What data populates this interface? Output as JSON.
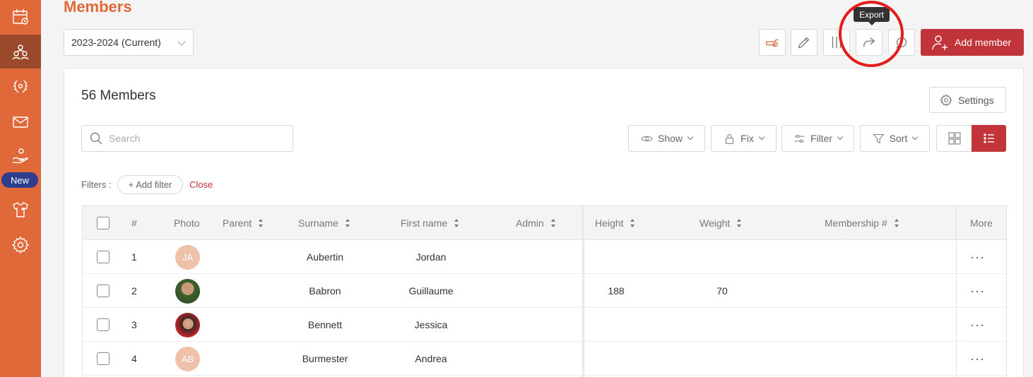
{
  "sidebar": {
    "items": [
      {
        "name": "calendar",
        "icon": "calendar-icon",
        "active": false
      },
      {
        "name": "members",
        "icon": "people-icon",
        "active": true
      },
      {
        "name": "competitions",
        "icon": "laurel-icon",
        "active": false
      },
      {
        "name": "messages",
        "icon": "mail-icon",
        "active": false
      },
      {
        "name": "donations",
        "icon": "hand-heart-icon",
        "active": false
      },
      {
        "name": "equipment",
        "icon": "shirt-icon",
        "active": false
      },
      {
        "name": "settings",
        "icon": "gear-icon",
        "active": false
      }
    ],
    "new_badge": "New",
    "accent": "#e0693a"
  },
  "header": {
    "title": "Members",
    "season_select": "2023-2024 (Current)",
    "tooltip": "Export",
    "add_member_label": "Add member",
    "toolbar_icons": [
      "whistle-icon",
      "pencil-icon",
      "columns-icon",
      "export-icon",
      "chat-icon"
    ]
  },
  "panel": {
    "count_title": "56 Members",
    "settings_label": "Settings",
    "search_placeholder": "Search",
    "controls": {
      "show": "Show",
      "fix": "Fix",
      "filter": "Filter",
      "sort": "Sort"
    },
    "filters_label": "Filters :",
    "add_filter_label": "+ Add filter",
    "close_label": "Close"
  },
  "table": {
    "headers": {
      "number": "#",
      "photo": "Photo",
      "parent": "Parent",
      "surname": "Surname",
      "first_name": "First name",
      "admin": "Admin",
      "height": "Height",
      "weight": "Weight",
      "membership": "Membership #",
      "more": "More"
    },
    "rows": [
      {
        "num": "1",
        "avatar": "JA",
        "surname": "Aubertin",
        "first_name": "Jordan",
        "height": "",
        "weight": "",
        "more": "···"
      },
      {
        "num": "2",
        "avatar": "",
        "surname": "Babron",
        "first_name": "Guillaume",
        "height": "188",
        "weight": "70",
        "more": "···"
      },
      {
        "num": "3",
        "avatar": "",
        "surname": "Bennett",
        "first_name": "Jessica",
        "height": "",
        "weight": "",
        "more": "···"
      },
      {
        "num": "4",
        "avatar": "AB",
        "surname": "Burmester",
        "first_name": "Andrea",
        "height": "",
        "weight": "",
        "more": "···"
      }
    ]
  },
  "colors": {
    "primary_red": "#c0343a",
    "badge_blue": "#2f3d8f",
    "highlight_ring": "#e31c1c"
  }
}
